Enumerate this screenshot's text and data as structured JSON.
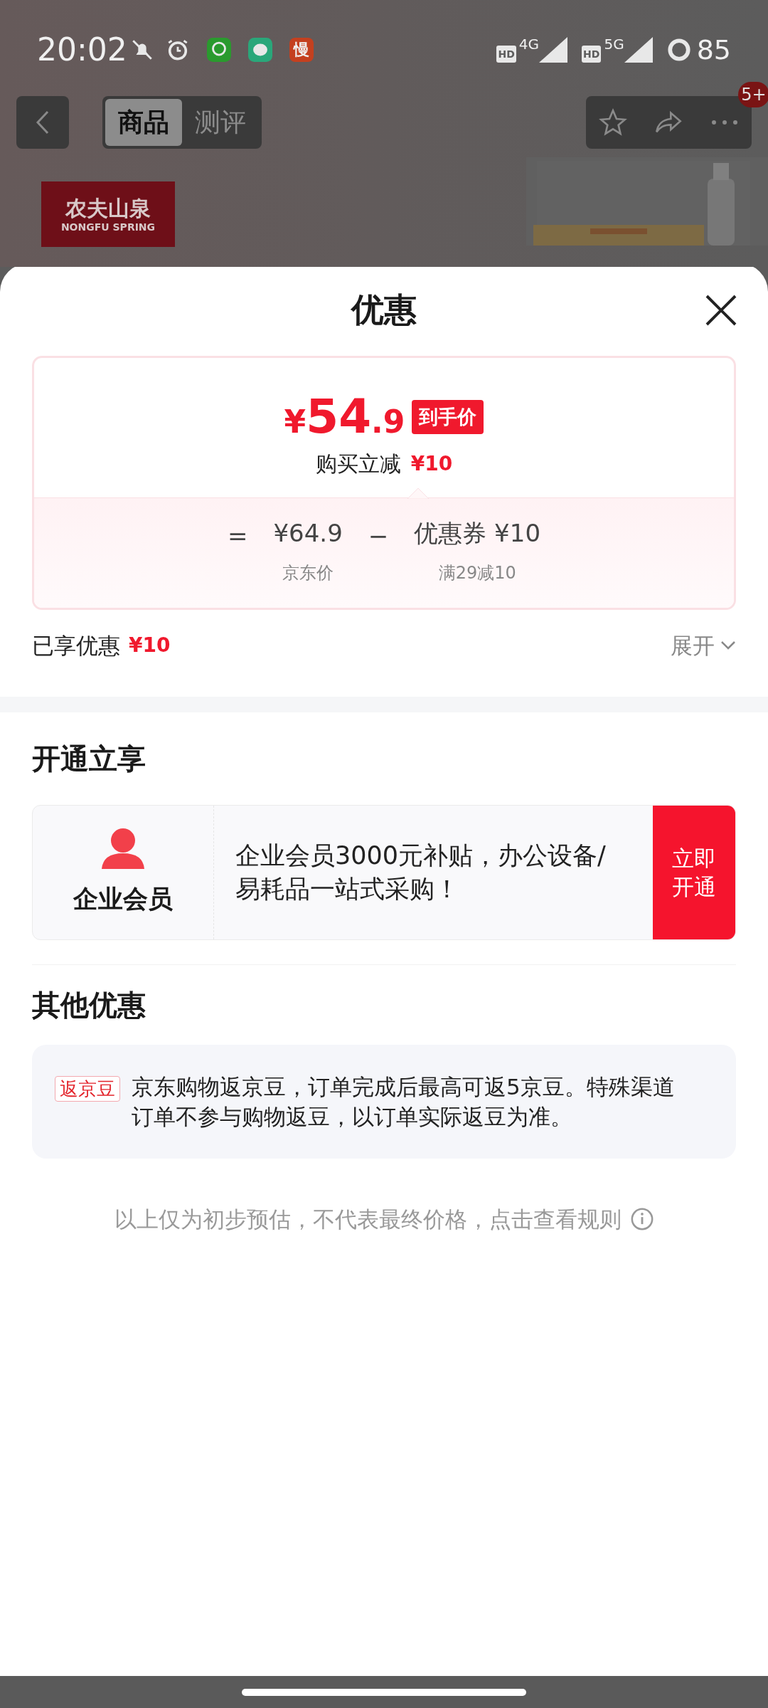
{
  "status_bar": {
    "time": "20:02",
    "app_icon_text": "慢",
    "networks": [
      {
        "hd": "HD",
        "label": "4G"
      },
      {
        "hd": "HD",
        "label": "5G"
      }
    ],
    "battery": "85"
  },
  "nav": {
    "tabs": [
      {
        "label": "商品",
        "selected": true
      },
      {
        "label": "测评",
        "selected": false
      }
    ],
    "badge": "5+"
  },
  "brand_logo": {
    "title": "农夫山泉",
    "subtitle": "NONGFU SPRING"
  },
  "sheet": {
    "title": "优惠",
    "price": {
      "currency": "¥",
      "integer": "54",
      "decimal": ".9",
      "tag": "到手价",
      "saving_label": "购买立减",
      "saving_amount": "¥10"
    },
    "formula": {
      "equals": "=",
      "original_price": "¥64.9",
      "minus": "−",
      "coupon": "优惠券 ¥10",
      "original_label": "京东价",
      "coupon_label": "满29减10"
    },
    "enjoyed": {
      "label": "已享优惠",
      "amount": "¥10",
      "expand": "展开",
      "expanded": false
    },
    "membership": {
      "title": "开通立享",
      "name": "企业会员",
      "description": "企业会员3000元补贴，办公设备/易耗品一站式采购！",
      "button": "立即开通"
    },
    "other": {
      "title": "其他优惠",
      "items": [
        {
          "tag": "返京豆",
          "text": "京东购物返京豆，订单完成后最高可返5京豆。特殊渠道订单不参与购物返豆，以订单实际返豆为准。"
        }
      ]
    },
    "footer_note": "以上仅为初步预估，不代表最终价格，点击查看规则"
  }
}
